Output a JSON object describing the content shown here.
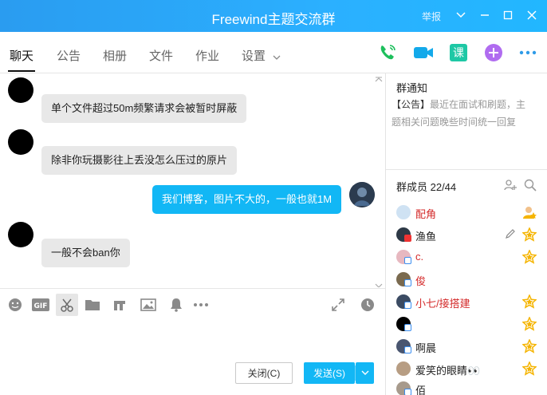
{
  "window": {
    "title": "Freewind主题交流群",
    "report": "举报"
  },
  "tabs": [
    {
      "label": "聊天"
    },
    {
      "label": "公告"
    },
    {
      "label": "相册"
    },
    {
      "label": "文件"
    },
    {
      "label": "作业"
    },
    {
      "label": "设置"
    }
  ],
  "messages": [
    {
      "text": "单个文件超过50m频繁请求会被暂时屏蔽",
      "direction": "in"
    },
    {
      "text": "除非你玩摄影往上丢没怎么压过的原片",
      "direction": "in"
    },
    {
      "text": "我们博客，图片不大的，一般也就1M",
      "direction": "out"
    },
    {
      "text": "一般不会ban你",
      "direction": "in"
    }
  ],
  "composer": {
    "gif_label": "GIF",
    "close_label": "关闭(C)",
    "send_label": "发送(S)"
  },
  "notice": {
    "title": "群通知",
    "tag": "【公告】",
    "text": "最近在面试和刷题，主题相关问题晚些时间统一回复"
  },
  "members": {
    "title": "群成员 22/44",
    "list": [
      {
        "name": "配角",
        "color": "#d42b2b"
      },
      {
        "name": "渔鱼",
        "color": "#222222"
      },
      {
        "name": "c.",
        "color": "#d42b2b"
      },
      {
        "name": "俊",
        "color": "#d42b2b"
      },
      {
        "name": "小七/接搭建",
        "color": "#d42b2b"
      },
      {
        "name": "",
        "color": "#222222"
      },
      {
        "name": "啊晨",
        "color": "#222222"
      },
      {
        "name": "爱笑的眼睛👀",
        "color": "#222222"
      },
      {
        "name": "佰",
        "color": "#222222"
      }
    ]
  },
  "colors": {
    "accent": "#12b7f5",
    "title_bar": "#2aa8f8",
    "admin_name": "#d42b2b",
    "star": "#f5b400"
  }
}
